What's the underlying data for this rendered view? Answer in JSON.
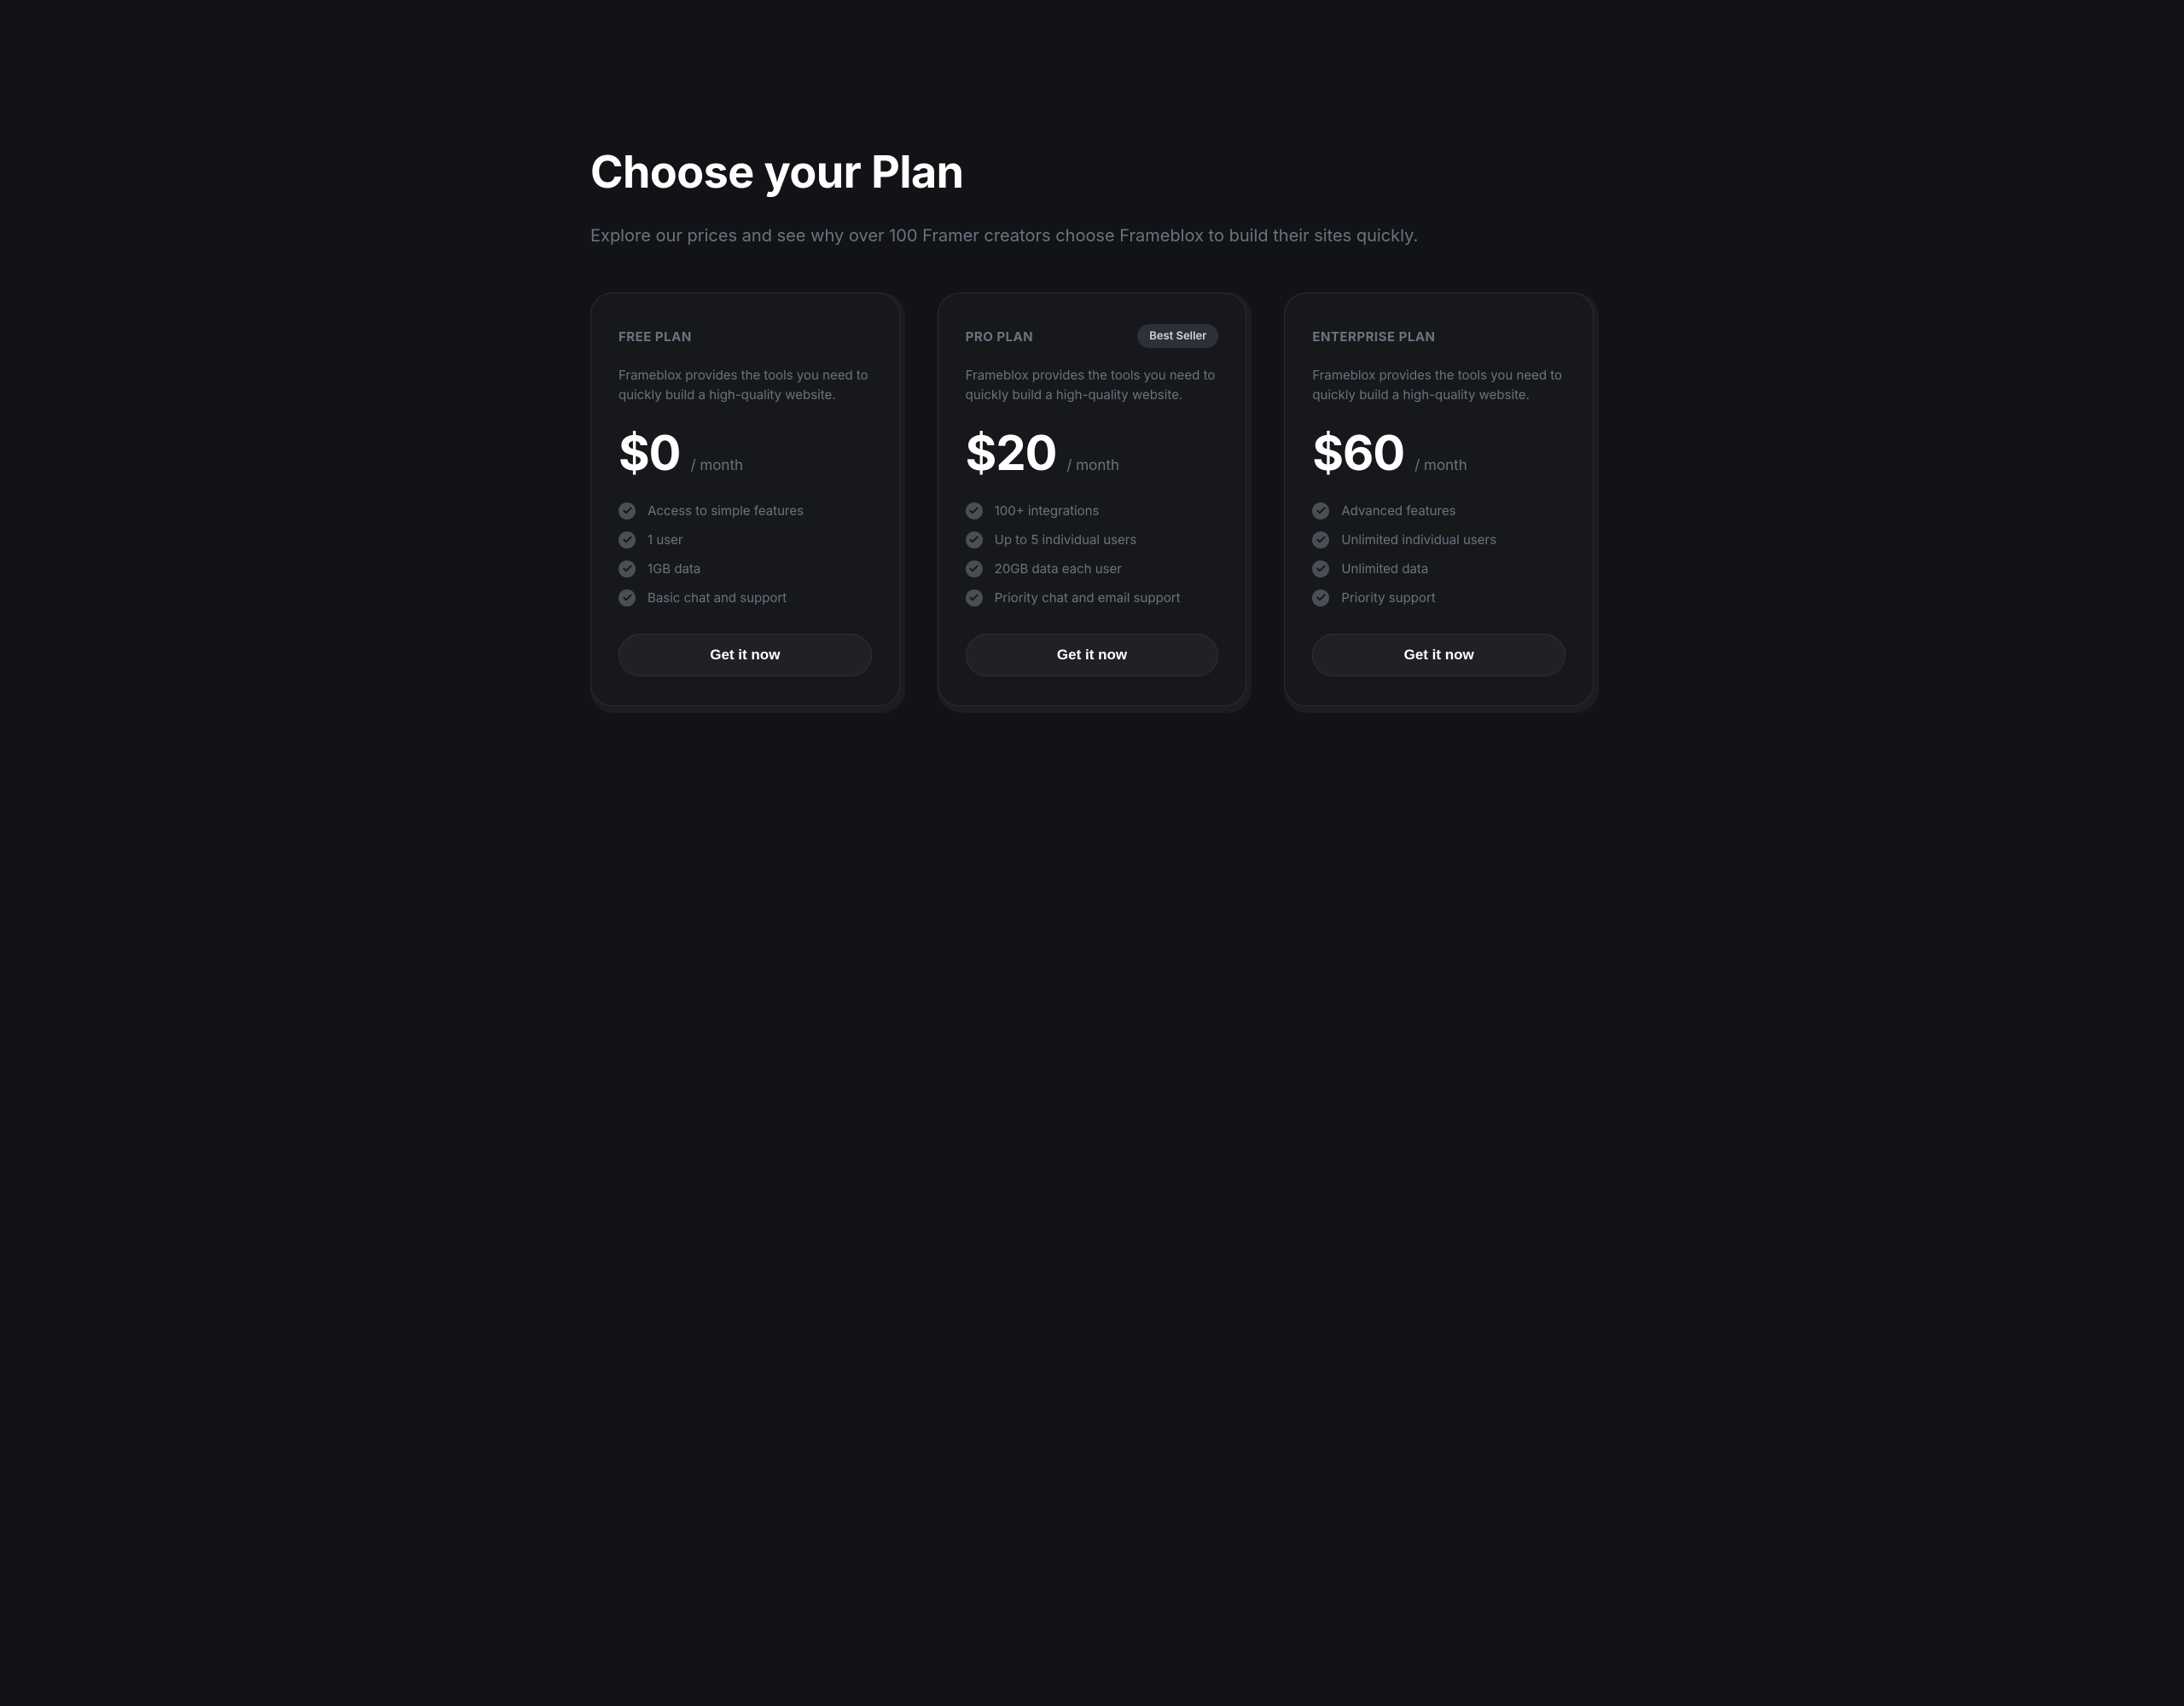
{
  "header": {
    "title": "Choose your Plan",
    "subtitle": "Explore our prices and see why over 100 Framer creators choose Frameblox to build their sites quickly."
  },
  "plans": [
    {
      "id": "free",
      "name": "FREE PLAN",
      "badge": null,
      "description": "Frameblox provides the tools you need to quickly build a high-quality website.",
      "price": "$0",
      "interval": "/ month",
      "features": [
        "Access to simple features",
        "1 user",
        "1GB data",
        "Basic chat and support"
      ],
      "cta": "Get it now"
    },
    {
      "id": "pro",
      "name": "PRO PLAN",
      "badge": "Best Seller",
      "description": "Frameblox provides the tools you need to quickly build a high-quality website.",
      "price": "$20",
      "interval": "/ month",
      "features": [
        "100+ integrations",
        "Up to 5 individual users",
        "20GB data each user",
        "Priority chat and email support"
      ],
      "cta": "Get it now"
    },
    {
      "id": "enterprise",
      "name": "ENTERPRISE PLAN",
      "badge": null,
      "description": "Frameblox provides the tools you need to quickly build a high-quality website.",
      "price": "$60",
      "interval": "/ month",
      "features": [
        "Advanced features",
        "Unlimited individual users",
        "Unlimited data",
        "Priority support"
      ],
      "cta": "Get it now"
    }
  ]
}
